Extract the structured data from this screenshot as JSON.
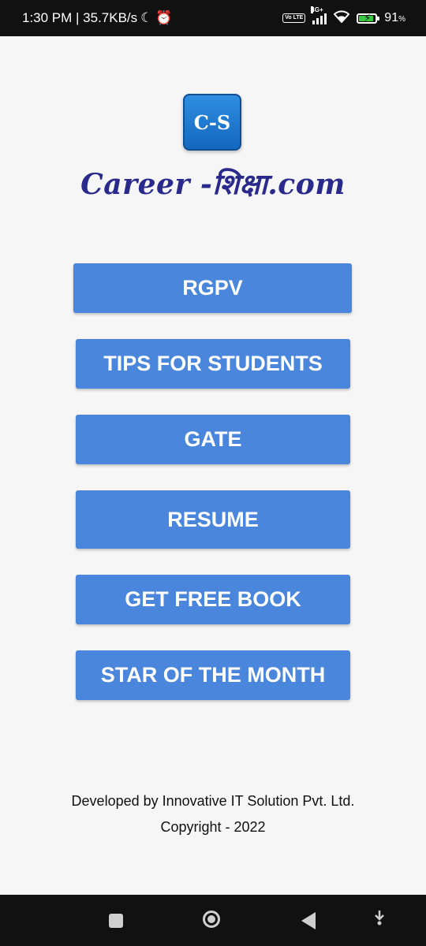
{
  "status_bar": {
    "time_speed": "1:30 PM | 35.7KB/s",
    "moon_glyph": "☾",
    "alarm_glyph": "⏰",
    "volte": "Vo LTE",
    "network": "4G+",
    "battery_percent": "91",
    "battery_level": 0.91,
    "battery_suffix": "%"
  },
  "logo": {
    "badge": "C-S",
    "wordmark": "Career -शिक्षा.com"
  },
  "menu": {
    "rgpv": "RGPV",
    "tips": "TIPS FOR STUDENTS",
    "gate": "GATE",
    "resume": "RESUME",
    "free_book": "GET FREE BOOK",
    "star": "STAR OF THE MONTH"
  },
  "footer": {
    "developer": "Developed by Innovative IT Solution Pvt. Ltd.",
    "copyright": "Copyright - 2022"
  },
  "colors": {
    "button": "#4a86db",
    "background": "#f6f6f6",
    "bars": "#111111",
    "logo_blue": "#1a76d2",
    "wordmark": "#2a2a8c"
  },
  "icons": {
    "recents": "square-icon",
    "home": "circle-home-icon",
    "back": "triangle-back-icon",
    "extra": "download-arrow-icon"
  }
}
